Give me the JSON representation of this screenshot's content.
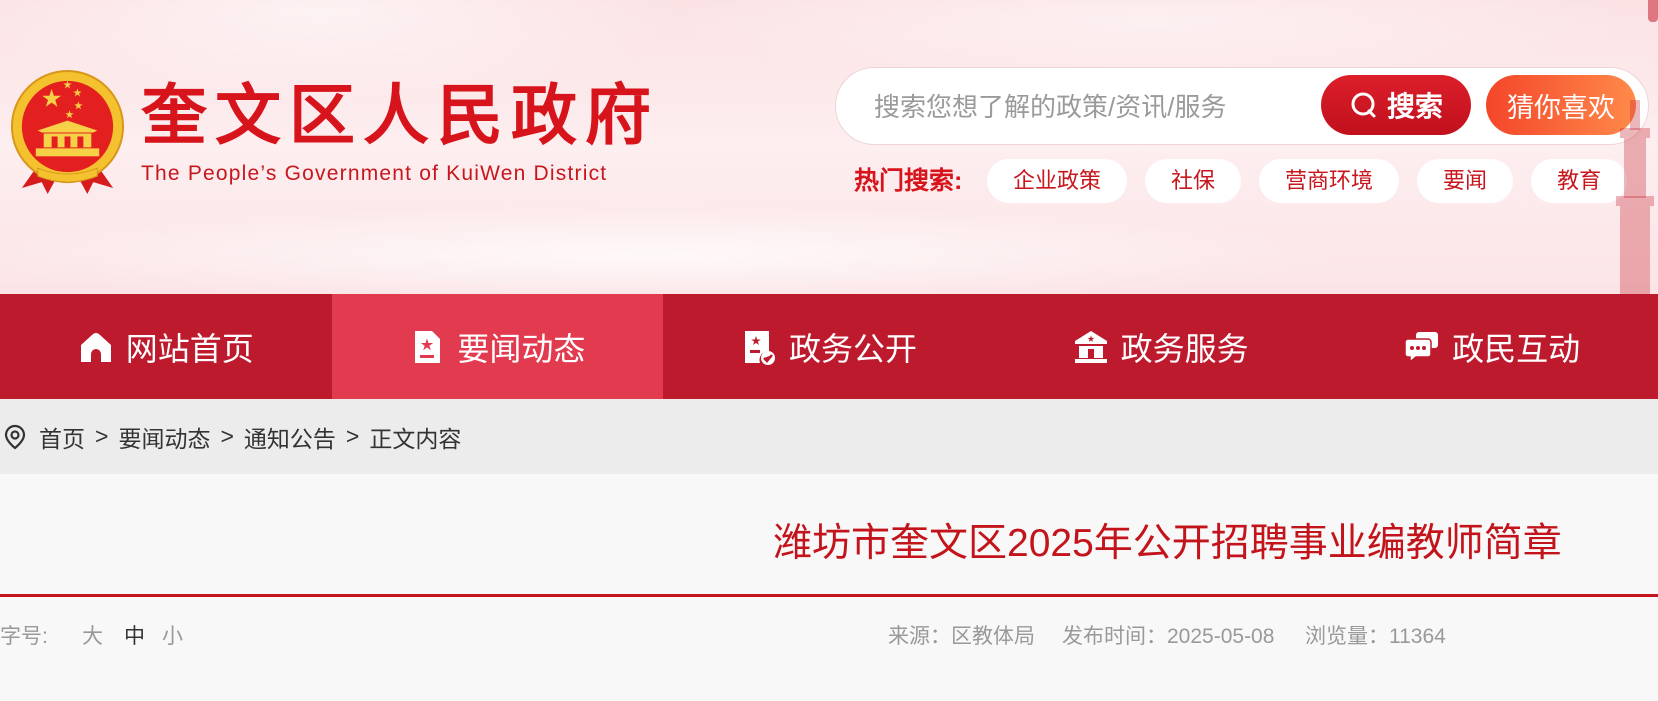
{
  "site": {
    "title": "奎文区人民政府",
    "subtitle": "The People’s Government of KuiWen District",
    "emblem_icon": "national-emblem-icon"
  },
  "search": {
    "placeholder": "搜索您想了解的政策/资讯/服务",
    "value": "",
    "button_label": "搜索",
    "button_icon": "search-icon",
    "guess_label": "猜你喜欢"
  },
  "hot_search": {
    "label": "热门搜索:",
    "tags": [
      "企业政策",
      "社保",
      "营商环境",
      "要闻",
      "教育"
    ]
  },
  "nav": {
    "active_index": 1,
    "items": [
      {
        "label": "网站首页",
        "icon": "home-icon"
      },
      {
        "label": "要闻动态",
        "icon": "document-star-icon"
      },
      {
        "label": "政务公开",
        "icon": "document-badge-icon"
      },
      {
        "label": "政务服务",
        "icon": "building-star-icon"
      },
      {
        "label": "政民互动",
        "icon": "chat-bubbles-icon"
      }
    ]
  },
  "breadcrumb": {
    "icon": "location-pin-icon",
    "separator": ">",
    "items": [
      "首页",
      "要闻动态",
      "通知公告",
      "正文内容"
    ]
  },
  "article": {
    "title": "潍坊市奎文区2025年公开招聘事业编教师简章",
    "font_size_label": "字号:",
    "font_sizes": [
      "大",
      "中",
      "小"
    ],
    "selected_font_size_index": 1,
    "source": "来源：区教体局",
    "publish_time": "发布时间：2025-05-08",
    "views": "浏览量：11364"
  },
  "colors": {
    "brand_red": "#d7141b",
    "nav_bg": "#be1a2d",
    "nav_active_bg": "#e23b50",
    "guess_button": "#f5552e",
    "breadcrumb_bg": "#ececec",
    "content_bg": "#f8f8f8"
  }
}
